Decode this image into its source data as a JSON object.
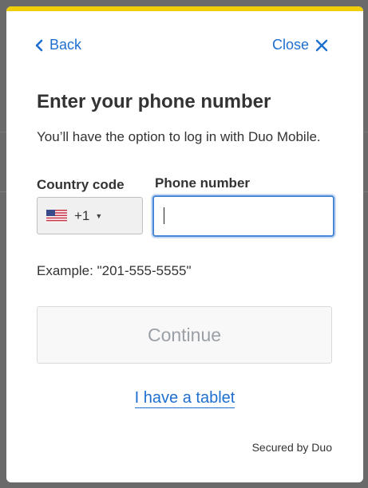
{
  "nav": {
    "back_label": "Back",
    "close_label": "Close",
    "back_icon": "chevron-left-icon",
    "close_icon": "close-x-icon"
  },
  "heading": {
    "title": "Enter your phone number",
    "subtitle": "You’ll have the option to log in with Duo Mobile."
  },
  "form": {
    "country_code_label": "Country code",
    "country_code_value": "+1",
    "country_flag": "us-flag-icon",
    "phone_number_label": "Phone number",
    "phone_number_value": "",
    "example_text": "Example: \"201-555-5555\""
  },
  "actions": {
    "continue_label": "Continue",
    "tablet_link": "I have a tablet"
  },
  "footer": {
    "secured_text": "Secured by Duo"
  },
  "colors": {
    "accent": "#f0cf09",
    "link": "#1e6fd0",
    "focus": "#4a86d8",
    "disabled_text": "#9aa0a6"
  }
}
